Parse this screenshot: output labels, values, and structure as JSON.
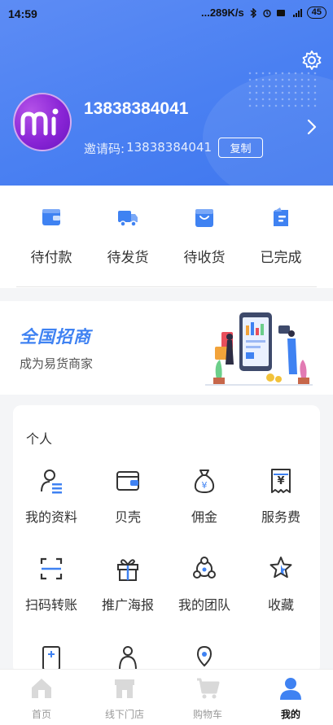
{
  "status_bar": {
    "time": "14:59",
    "network_speed": "...289K/s",
    "battery": "45",
    "icons": [
      "bluetooth-icon",
      "alarm-icon",
      "hd-icon",
      "4g-signal-icon"
    ]
  },
  "profile": {
    "username": "13838384041",
    "invite_label": "邀请码:",
    "invite_code": "13838384041",
    "copy_label": "复制",
    "settings_icon": "gear-icon",
    "arrow_icon": "chevron-right-icon"
  },
  "orders": [
    {
      "label": "待付款",
      "icon": "wallet-icon"
    },
    {
      "label": "待发货",
      "icon": "truck-icon"
    },
    {
      "label": "待收货",
      "icon": "bag-icon"
    },
    {
      "label": "已完成",
      "icon": "done-icon"
    }
  ],
  "banner": {
    "title": "全国招商",
    "subtitle": "成为易货商家"
  },
  "personal": {
    "title": "个人",
    "items": [
      {
        "label": "我的资料",
        "icon": "profile-icon"
      },
      {
        "label": "贝壳",
        "icon": "wallet-icon"
      },
      {
        "label": "佣金",
        "icon": "money-bag-icon"
      },
      {
        "label": "服务费",
        "icon": "receipt-icon"
      },
      {
        "label": "扫码转账",
        "icon": "scan-icon"
      },
      {
        "label": "推广海报",
        "icon": "gift-icon"
      },
      {
        "label": "我的团队",
        "icon": "team-icon"
      },
      {
        "label": "收藏",
        "icon": "star-icon"
      }
    ]
  },
  "tabbar": {
    "items": [
      {
        "label": "首页",
        "icon": "home-icon"
      },
      {
        "label": "线下门店",
        "icon": "store-icon"
      },
      {
        "label": "购物车",
        "icon": "cart-icon"
      },
      {
        "label": "我的",
        "icon": "user-icon"
      }
    ],
    "active_index": 3
  },
  "colors": {
    "header_blue": "#4a80f2",
    "accent_blue": "#3f82f2",
    "avatar_purple": "#8a25d6"
  }
}
